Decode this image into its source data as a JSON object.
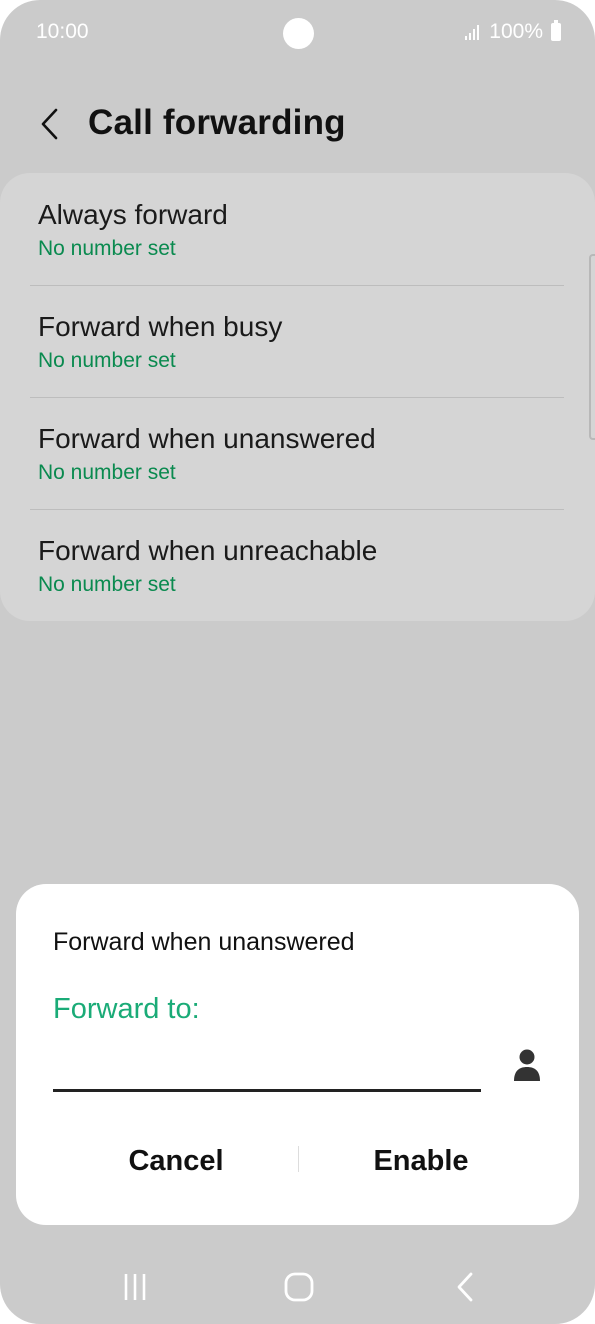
{
  "status_bar": {
    "time": "10:00",
    "battery": "100%"
  },
  "header": {
    "title": "Call forwarding"
  },
  "items": [
    {
      "title": "Always forward",
      "subtitle": "No number set"
    },
    {
      "title": "Forward when busy",
      "subtitle": "No number set"
    },
    {
      "title": "Forward when unanswered",
      "subtitle": "No number set"
    },
    {
      "title": "Forward when unreachable",
      "subtitle": "No number set"
    }
  ],
  "dialog": {
    "title": "Forward when unanswered",
    "label": "Forward to:",
    "input_value": "",
    "cancel": "Cancel",
    "enable": "Enable"
  },
  "colors": {
    "accent_green": "#0a8a4f",
    "dialog_label_green": "#1aab77",
    "background": "#cbcbcb"
  },
  "icons": [
    "back-arrow-icon",
    "contact-icon",
    "recents-icon",
    "home-icon",
    "nav-back-icon",
    "signal-icon",
    "battery-icon"
  ]
}
